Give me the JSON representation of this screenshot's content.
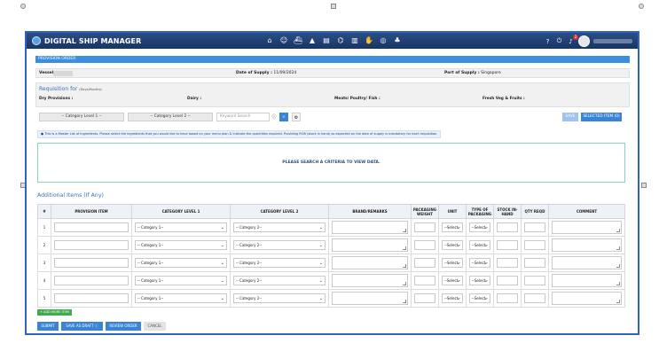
{
  "app": {
    "title": "DIGITAL SHIP MANAGER"
  },
  "nav_icons": [
    "home-icon",
    "crew-icon",
    "ship-icon",
    "chart-icon",
    "document-icon",
    "bank-icon",
    "analytics-icon",
    "hand-icon",
    "compass-icon",
    "org-icon"
  ],
  "notification_count": "2",
  "section": {
    "title": "PROVISION ORDER"
  },
  "vessel": {
    "label": "Vessel:"
  },
  "supply": {
    "date_label": "Date of Supply :",
    "date_value": "11/09/2024",
    "port_label": "Port of Supply :",
    "port_value": "Singapore"
  },
  "requisition": {
    "title": "Requisition for",
    "subtitle": "(Days/Months)",
    "dry_label": "Dry Provisions :",
    "dairy_label": "Dairy :",
    "meats_label": "Meats/ Poultry/ Fish :",
    "fresh_label": "Fresh Veg & Fruits :"
  },
  "filters": {
    "category1": "-- Category Level 1 --",
    "category2": "-- Category Level 2 --",
    "search_placeholder": "Keyword Search"
  },
  "buttons": {
    "save": "SAVE",
    "selected_items": "SELECTED ITEM (0)",
    "add_more": "+ ADD MORE ITEM",
    "submit": "SUBMIT",
    "save_draft": "SAVE AS DRAFT",
    "review": "REVIEW ORDER",
    "cancel": "CANCEL"
  },
  "info_note": "This is a Master List of Ingredients. Please select the ingredients that you would like to have based on your menu plan & indicate the quantities required. Providing ROB (stock in hand) as expected on the date of supply is mandatory for each requisition.",
  "empty_state": "PLEASE SEARCH A CRITERIA TO VIEW DATA.",
  "additional": {
    "title": "Additional Items (If Any)",
    "headers": [
      "#",
      "PROVISION ITEM",
      "CATEGORY LEVEL 1",
      "CATEGORY LEVEL 2",
      "BRAND/REMARKS",
      "PACKAGING WEIGHT",
      "UNIT",
      "TYPE OF PACKAGING",
      "STOCK IN-HAND",
      "QTY REQD",
      "COMMENT"
    ],
    "rows": [
      "1",
      "2",
      "3",
      "4",
      "5"
    ],
    "cat1_default": "-- Category 1--",
    "cat2_default": "-- Category 2--",
    "select_default": "--Select--"
  }
}
